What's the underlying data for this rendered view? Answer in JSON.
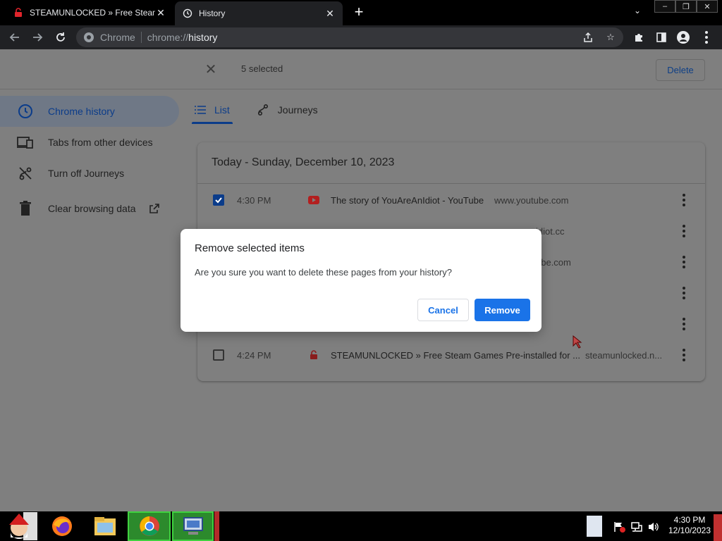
{
  "browser": {
    "tabs": [
      {
        "title": "STEAMUNLOCKED » Free Steam Games",
        "active": false,
        "icon": "lock-icon"
      },
      {
        "title": "History",
        "active": true,
        "icon": "history-icon"
      }
    ],
    "new_tab_label": "+",
    "omnibox": {
      "site_chip": "Chrome",
      "url_scheme": "chrome://",
      "url_host": "history"
    }
  },
  "history": {
    "selected_text": "5 selected",
    "delete_label": "Delete",
    "sidebar": [
      {
        "label": "Chrome history",
        "icon": "clock-icon",
        "active": true
      },
      {
        "label": "Tabs from other devices",
        "icon": "devices-icon",
        "active": false
      },
      {
        "label": "Turn off Journeys",
        "icon": "journeys-off-icon",
        "active": false
      },
      {
        "label": "Clear browsing data",
        "icon": "trash-icon",
        "active": false,
        "external": true
      }
    ],
    "tabs": [
      {
        "label": "List",
        "active": true
      },
      {
        "label": "Journeys",
        "active": false
      }
    ],
    "day_header": "Today - Sunday, December 10, 2023",
    "rows": [
      {
        "time": "4:30 PM",
        "title": "The story of YouAreAnIdiot - YouTube",
        "domain": "www.youtube.com",
        "checked": true,
        "favicon": "youtube-icon"
      },
      {
        "time": "",
        "title": "",
        "domain": "idiot.cc",
        "checked": true,
        "favicon": ""
      },
      {
        "time": "",
        "title": "",
        "domain": "ube.com",
        "checked": true,
        "favicon": ""
      },
      {
        "time": "",
        "title": "",
        "domain": "",
        "checked": true,
        "favicon": ""
      },
      {
        "time": "",
        "title": "",
        "domain": "",
        "checked": true,
        "favicon": ""
      },
      {
        "time": "4:24 PM",
        "title": "STEAMUNLOCKED » Free Steam Games Pre-installed for ...",
        "domain": "steamunlocked.n...",
        "checked": false,
        "favicon": "lock-icon"
      }
    ]
  },
  "dialog": {
    "title": "Remove selected items",
    "body": "Are you sure you want to delete these pages from your history?",
    "cancel_label": "Cancel",
    "remove_label": "Remove"
  },
  "taskbar": {
    "clock_time": "4:30 PM",
    "clock_date": "12/10/2023"
  },
  "colors": {
    "accent": "#1a73e8",
    "dimmed_accent": "#0b3c8a",
    "scrim_bg": "#7f7f7f"
  }
}
